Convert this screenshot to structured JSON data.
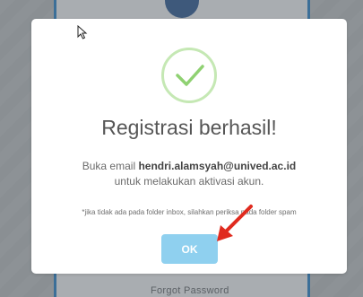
{
  "background": {
    "bottom_text": "Forgot Password"
  },
  "dialog": {
    "title": "Registrasi berhasil!",
    "message_prefix": "Buka email",
    "email": "hendri.alamsyah@unived.ac.id",
    "message_suffix": "untuk melakukan aktivasi akun.",
    "note": "*jika tidak ada pada folder inbox, silahkan periksa pada folder spam",
    "ok_label": "OK",
    "icon": "checkmark-icon"
  },
  "colors": {
    "ok_button": "#8fd0ef",
    "success_ring": "#c5e8b4",
    "checkmark": "#8fd172",
    "annotation_arrow": "#e02b1f"
  }
}
